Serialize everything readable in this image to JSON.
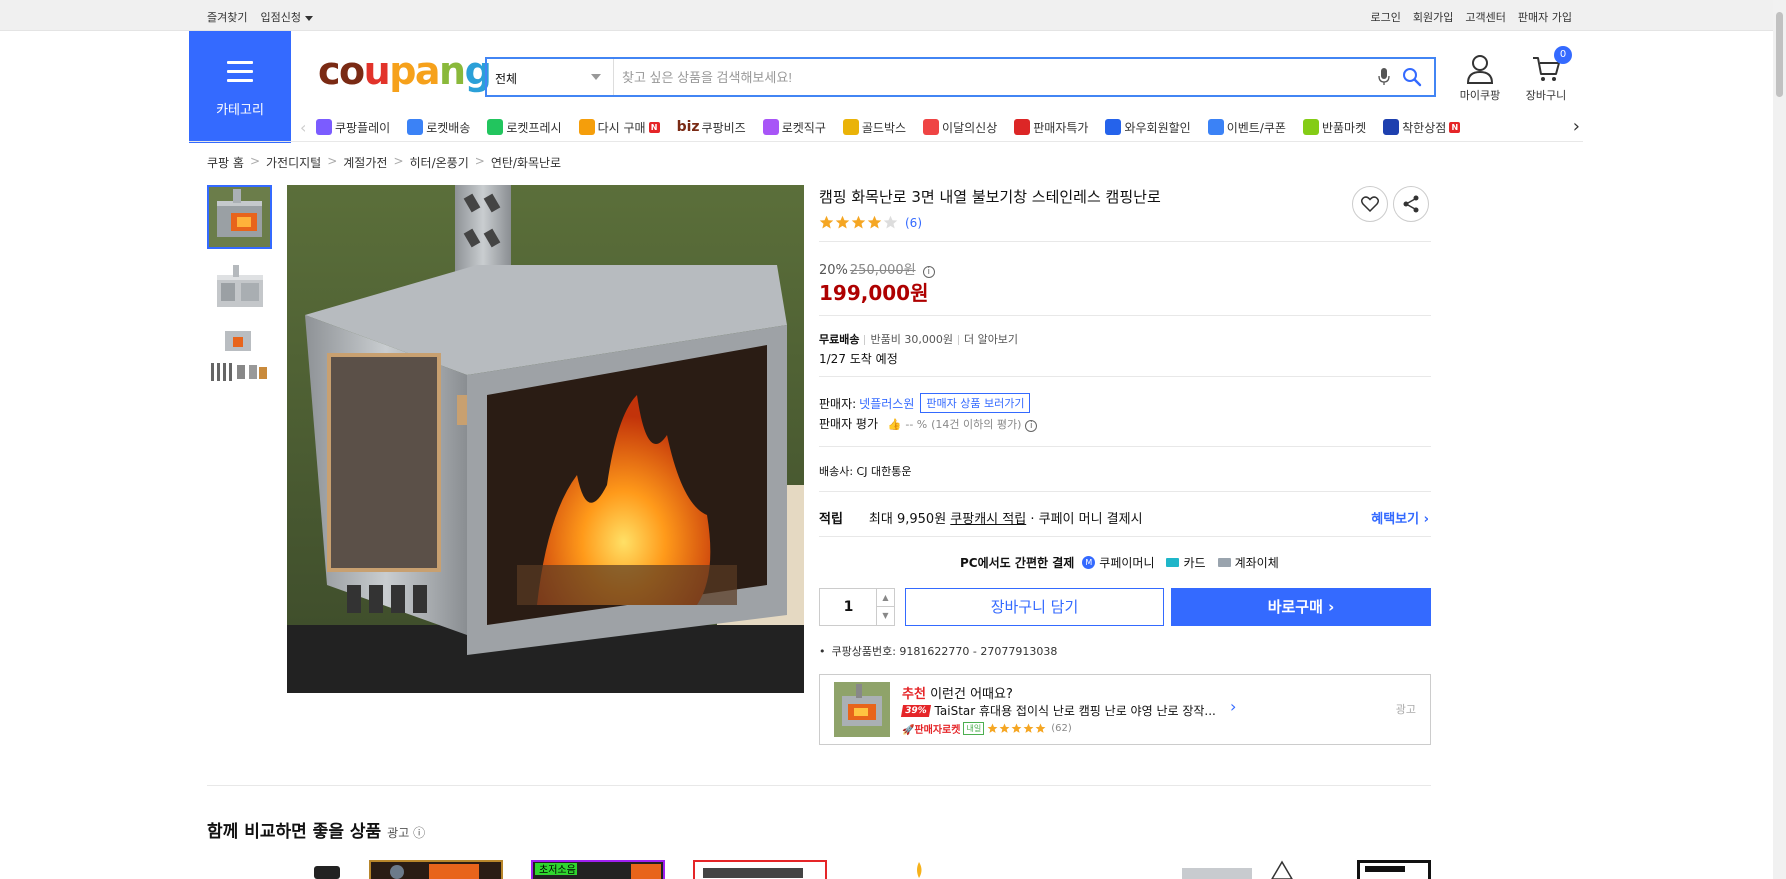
{
  "topbar": {
    "left": [
      "즐겨찾기",
      "입점신청"
    ],
    "right": [
      "로그인",
      "회원가입",
      "고객센터",
      "판매자 가입"
    ]
  },
  "category_label": "카테고리",
  "logo": {
    "c1": "co",
    "c2": "u",
    "c3": "pa",
    "c4": "n",
    "c5": "g"
  },
  "search": {
    "scope": "전체",
    "placeholder": "찾고 싶은 상품을 검색해보세요!"
  },
  "header": {
    "mycoupang": "마이쿠팡",
    "cart": "장바구니",
    "cart_count": "0"
  },
  "nav": [
    {
      "label": "쿠팡플레이",
      "icon": "play-icon",
      "color": "#7b5cff"
    },
    {
      "label": "로켓배송",
      "icon": "rocket-icon",
      "color": "#3b82f6"
    },
    {
      "label": "로켓프레시",
      "icon": "fresh-rocket-icon",
      "color": "#22c55e"
    },
    {
      "label": "다시 구매",
      "icon": "house-icon",
      "color": "#f59e0b"
    },
    {
      "label": "쿠팡비즈",
      "icon": "biz-icon",
      "color": "#7a2a14",
      "prefix": "biz"
    },
    {
      "label": "로켓직구",
      "icon": "globe-icon",
      "color": "#a855f7"
    },
    {
      "label": "골드박스",
      "icon": "goldbox-icon",
      "color": "#eab308"
    },
    {
      "label": "이달의신상",
      "icon": "bag-icon",
      "color": "#ef4444"
    },
    {
      "label": "판매자특가",
      "icon": "percent-icon",
      "color": "#dc2626"
    },
    {
      "label": "와우회원할인",
      "icon": "wow-icon",
      "color": "#2563eb"
    },
    {
      "label": "이벤트/쿠폰",
      "icon": "coupon-icon",
      "color": "#3b82f6"
    },
    {
      "label": "반품마켓",
      "icon": "market-icon",
      "color": "#84cc16"
    },
    {
      "label": "착한상점",
      "icon": "store-icon",
      "color": "#1e40af"
    }
  ],
  "new_badge": "N",
  "breadcrumbs": [
    "쿠팡 홈",
    "가전디지털",
    "계절가전",
    "히터/온풍기",
    "연탄/화목난로"
  ],
  "product": {
    "title": "캠핑 화목난로 3면 내열 불보기창 스테인레스 캠핑난로",
    "rating": 4,
    "review_count": "(6)",
    "discount": "20%",
    "original_price": "250,000원",
    "price": "199,000원",
    "shipping_free": "무료배송",
    "return_fee": "반품비 30,000원",
    "more_info": "더 알아보기",
    "arrival": "1/27 도착 예정",
    "seller_label": "판매자:",
    "seller_name": "넷플러스원",
    "seller_link": "판매자 상품 보러가기",
    "seller_rating_label": "판매자 평가",
    "seller_rating_value": "-- %",
    "seller_rating_note": "(14건 이하의 평가)",
    "carrier": "배송사:  CJ 대한통운",
    "reward_label": "적립",
    "reward_text1": "최대 9,950원",
    "reward_link": "쿠팡캐시 적립",
    "reward_text2": "· 쿠페이 머니 결제시",
    "reward_more": "혜택보기",
    "pay_title": "PC에서도 간편한 결제",
    "pay_methods": [
      "쿠페이머니",
      "카드",
      "계좌이체"
    ],
    "quantity": "1",
    "add_cart": "장바구니 담기",
    "buy_now": "바로구매",
    "product_number": "쿠팡상품번호: 9181622770 - 27077913038"
  },
  "reco": {
    "tag": "추천",
    "title": "이런건 어때요?",
    "discount": "39%",
    "name": "TaiStar 휴대용 접이식 난로 캠핑 난로 야영 난로 장작...",
    "rocket": "판매자로켓",
    "tomorrow": "내일",
    "rating": 5,
    "count": "(62)",
    "ad": "광고"
  },
  "section": {
    "title": "함께 비교하면 좋을 상품",
    "ad": "광고"
  },
  "colors": {
    "accent": "#346aff",
    "price": "#ae0000",
    "star": "#f5a623"
  }
}
